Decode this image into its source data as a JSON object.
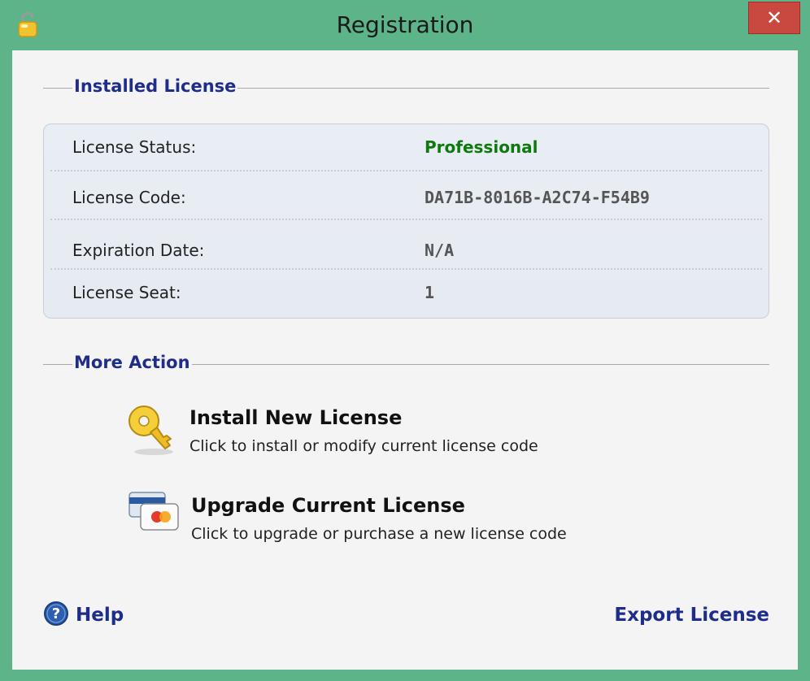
{
  "window": {
    "title": "Registration",
    "close_glyph": "✕",
    "icon": "padlock-icon"
  },
  "installed": {
    "heading": "Installed License",
    "rows": [
      {
        "key": "License Status:",
        "value": "Professional",
        "value_color": "#0e7a0e"
      },
      {
        "key": "License Code:",
        "value": "DA71B-8016B-A2C74-F54B9"
      },
      {
        "key": "Expiration Date:",
        "value": "N/A"
      },
      {
        "key": "License Seat:",
        "value": "1"
      }
    ]
  },
  "more": {
    "heading": "More Action",
    "actions": [
      {
        "title": "Install New License",
        "desc": "Click to install or modify current license code",
        "icon": "key-icon"
      },
      {
        "title": "Upgrade Current License",
        "desc": "Click to upgrade or purchase a new license code",
        "icon": "credit-card-icon"
      }
    ]
  },
  "footer": {
    "help_label": "Help",
    "help_icon": "question-icon",
    "export_label": "Export License"
  },
  "colors": {
    "frame": "#5cb488",
    "heading": "#1f2d8a",
    "close": "#c9483f"
  }
}
